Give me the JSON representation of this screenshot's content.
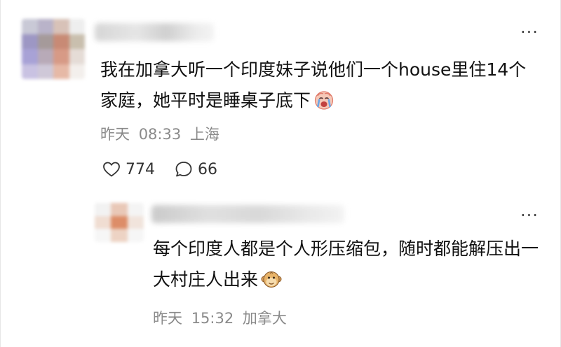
{
  "comments": [
    {
      "text": "我在加拿大听一个印度妹子说他们一个house里住14个家庭，她平时是睡桌子底下",
      "emoji": "crying-face-emoji",
      "date": "昨天",
      "time": "08:33",
      "location": "上海",
      "likes": "774",
      "replies": "66",
      "like_icon": "heart-outline-icon",
      "reply_icon": "speech-bubble-icon",
      "more_icon": "more-dots-icon",
      "more_label": "···"
    },
    {
      "text": "每个印度人都是个人形压缩包，随时都能解压出一大村庄人出来",
      "emoji": "monkey-face-emoji",
      "date": "昨天",
      "time": "15:32",
      "location": "加拿大",
      "more_icon": "more-dots-icon",
      "more_label": "···"
    }
  ],
  "colors": {
    "text": "#111111",
    "meta": "#8a8a8a",
    "icon": "#333333",
    "background": "#ffffff"
  }
}
